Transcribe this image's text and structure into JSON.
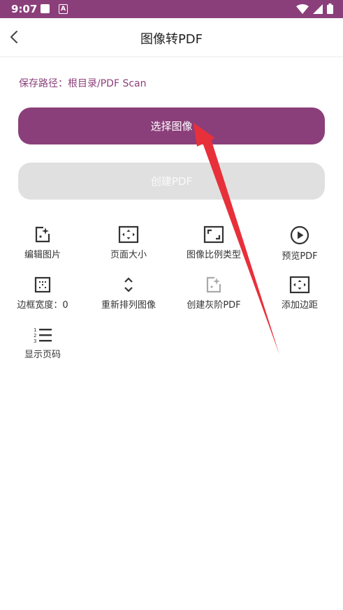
{
  "status_bar": {
    "time": "9:07"
  },
  "appbar": {
    "title": "图像转PDF"
  },
  "save_path": {
    "label": "保存路径：根目录/PDF Scan"
  },
  "buttons": {
    "select_image": "选择图像",
    "create_pdf": "创建PDF"
  },
  "tools": [
    {
      "label": "编辑图片",
      "icon": "edit-image-icon"
    },
    {
      "label": "页面大小",
      "icon": "page-size-icon"
    },
    {
      "label": "图像比例类型",
      "icon": "aspect-ratio-icon"
    },
    {
      "label": "预览PDF",
      "icon": "play-icon"
    },
    {
      "label": "边框宽度：0",
      "icon": "border-icon"
    },
    {
      "label": "重新排列图像",
      "icon": "rearrange-icon"
    },
    {
      "label": "创建灰阶PDF",
      "icon": "grayscale-icon"
    },
    {
      "label": "添加边距",
      "icon": "margin-icon"
    },
    {
      "label": "显示页码",
      "icon": "page-number-icon"
    }
  ],
  "colors": {
    "primary": "#8b3f7a",
    "annotation_arrow": "#e8303a"
  }
}
